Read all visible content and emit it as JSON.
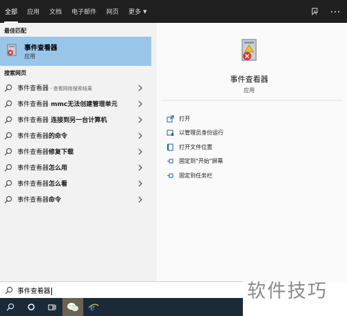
{
  "tabs": [
    {
      "label": "全部",
      "active": true
    },
    {
      "label": "应用"
    },
    {
      "label": "文档"
    },
    {
      "label": "电子邮件"
    },
    {
      "label": "网页"
    },
    {
      "label": "更多"
    }
  ],
  "best_match": {
    "section_title": "最佳匹配",
    "name": "事件查看器",
    "type": "应用"
  },
  "web_search": {
    "section_title": "搜索网页",
    "results": [
      {
        "prefix": "事件查看器",
        "bold": "",
        "sub": "- 查看网络搜索结果"
      },
      {
        "prefix": "事件查看器",
        "bold": " mmc无法创建管理单元",
        "sub": ""
      },
      {
        "prefix": "事件查看器",
        "bold": " 连接到另一台计算机",
        "sub": ""
      },
      {
        "prefix": "事件查看器",
        "bold": "的命令",
        "sub": ""
      },
      {
        "prefix": "事件查看器",
        "bold": "修复下载",
        "sub": ""
      },
      {
        "prefix": "事件查看器",
        "bold": "怎么用",
        "sub": ""
      },
      {
        "prefix": "事件查看器",
        "bold": "怎么看",
        "sub": ""
      },
      {
        "prefix": "事件查看器",
        "bold": "命令",
        "sub": ""
      }
    ]
  },
  "preview": {
    "name": "事件查看器",
    "type": "应用",
    "actions": [
      {
        "label": "打开",
        "icon": "open-icon"
      },
      {
        "label": "以管理员身份运行",
        "icon": "shield-icon"
      },
      {
        "label": "打开文件位置",
        "icon": "file-location-icon"
      },
      {
        "label": "固定到\"开始\"屏幕",
        "icon": "pin-icon"
      },
      {
        "label": "固定到任务栏",
        "icon": "pin-icon"
      }
    ]
  },
  "search": {
    "value": "事件查看器"
  },
  "watermark": "软件技巧",
  "colors": {
    "selected": "#99c6e8",
    "topbar": "#1f1f1f",
    "taskbar": "#1b2a38"
  }
}
